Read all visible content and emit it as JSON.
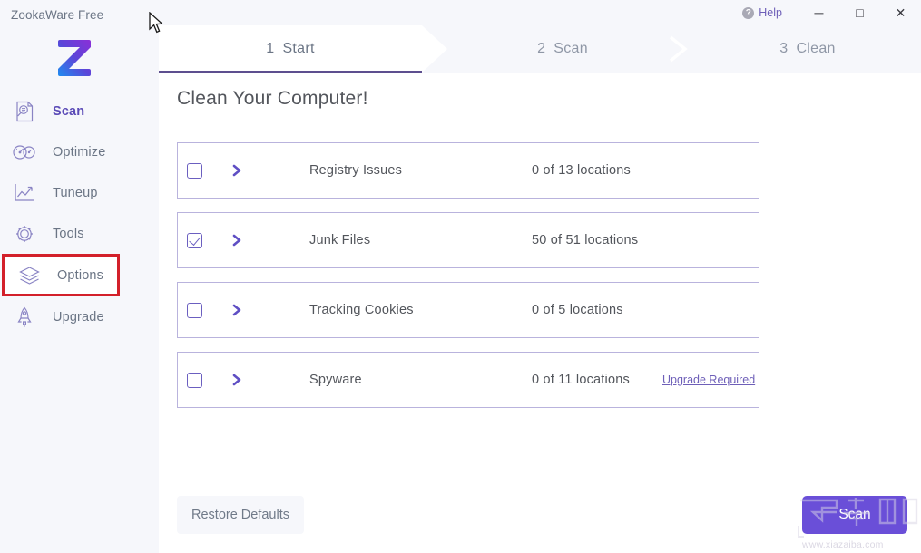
{
  "app": {
    "brand_title": "ZookaWare Free",
    "logo_letter": "Z",
    "accent_color": "#6a4fd8",
    "accent_color_dark": "#5b4bb7",
    "highlight_box_color": "#d3202a",
    "logo_gradient_from": "#1f8cf0",
    "logo_gradient_to": "#7b35d8"
  },
  "titlebar": {
    "help_label": "Help",
    "help_icon": "question-circle-icon",
    "minimize_label": "─",
    "maximize_label": "□",
    "close_label": "✕"
  },
  "sidebar": {
    "items": [
      {
        "label": "Scan",
        "icon": "document-search-icon",
        "active": true,
        "boxed": false
      },
      {
        "label": "Optimize",
        "icon": "gauges-icon",
        "active": false,
        "boxed": false
      },
      {
        "label": "Tuneup",
        "icon": "line-chart-icon",
        "active": false,
        "boxed": false
      },
      {
        "label": "Tools",
        "icon": "gear-icon",
        "active": false,
        "boxed": false
      },
      {
        "label": "Options",
        "icon": "layers-icon",
        "active": false,
        "boxed": true
      },
      {
        "label": "Upgrade",
        "icon": "rocket-icon",
        "active": false,
        "boxed": false
      }
    ]
  },
  "tabs": [
    {
      "num": "1",
      "label": "Start",
      "active": true
    },
    {
      "num": "2",
      "label": "Scan",
      "active": false
    },
    {
      "num": "3",
      "label": "Clean",
      "active": false
    }
  ],
  "main": {
    "page_title": "Clean Your Computer!",
    "rows": [
      {
        "name": "Registry Issues",
        "count": "0 of 13 locations",
        "checked": false,
        "upgrade": ""
      },
      {
        "name": "Junk Files",
        "count": "50 of 51 locations",
        "checked": true,
        "upgrade": ""
      },
      {
        "name": "Tracking Cookies",
        "count": "0 of 5 locations",
        "checked": false,
        "upgrade": ""
      },
      {
        "name": "Spyware",
        "count": "0 of 11 locations",
        "checked": false,
        "upgrade": "Upgrade Required"
      }
    ],
    "restore_label": "Restore Defaults",
    "scan_label": "Scan"
  },
  "watermark": {
    "text": "www.xiazaiba.com"
  }
}
